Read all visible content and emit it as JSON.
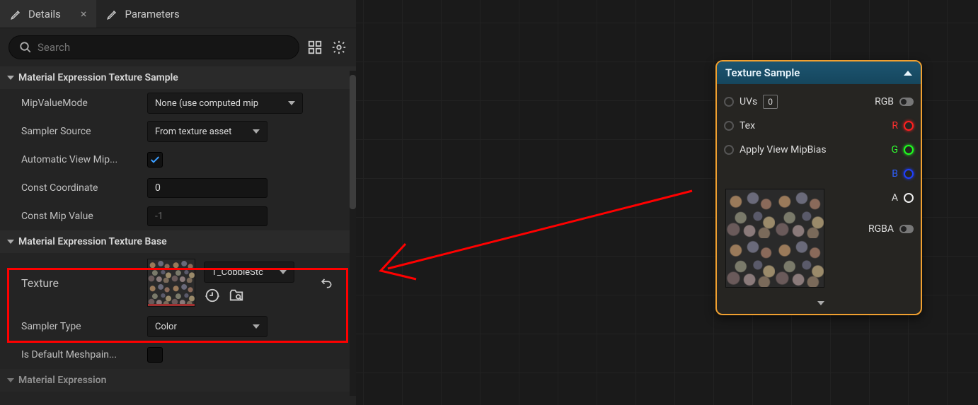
{
  "tabs": {
    "details": "Details",
    "parameters": "Parameters"
  },
  "search": {
    "placeholder": "Search"
  },
  "categories": {
    "texSample": "Material Expression Texture Sample",
    "texBase": "Material Expression Texture Base",
    "matExpr": "Material Expression"
  },
  "props": {
    "mipValueMode": {
      "label": "MipValueMode",
      "value": "None (use computed mip"
    },
    "samplerSource": {
      "label": "Sampler Source",
      "value": "From texture asset"
    },
    "autoViewMip": {
      "label": "Automatic View Mip..."
    },
    "constCoord": {
      "label": "Const Coordinate",
      "value": "0"
    },
    "constMip": {
      "label": "Const Mip Value",
      "value": "-1"
    },
    "texture": {
      "label": "Texture",
      "value": "T_CobbleStc"
    },
    "samplerType": {
      "label": "Sampler Type",
      "value": "Color"
    },
    "defaultMeshpaint": {
      "label": "Is Default Meshpain..."
    }
  },
  "node": {
    "title": "Texture Sample",
    "pins": {
      "uvs": "UVs",
      "uvsIdx": "0",
      "tex": "Tex",
      "applyMip": "Apply View MipBias",
      "rgb": "RGB",
      "r": "R",
      "g": "G",
      "b": "B",
      "a": "A",
      "rgba": "RGBA"
    }
  }
}
